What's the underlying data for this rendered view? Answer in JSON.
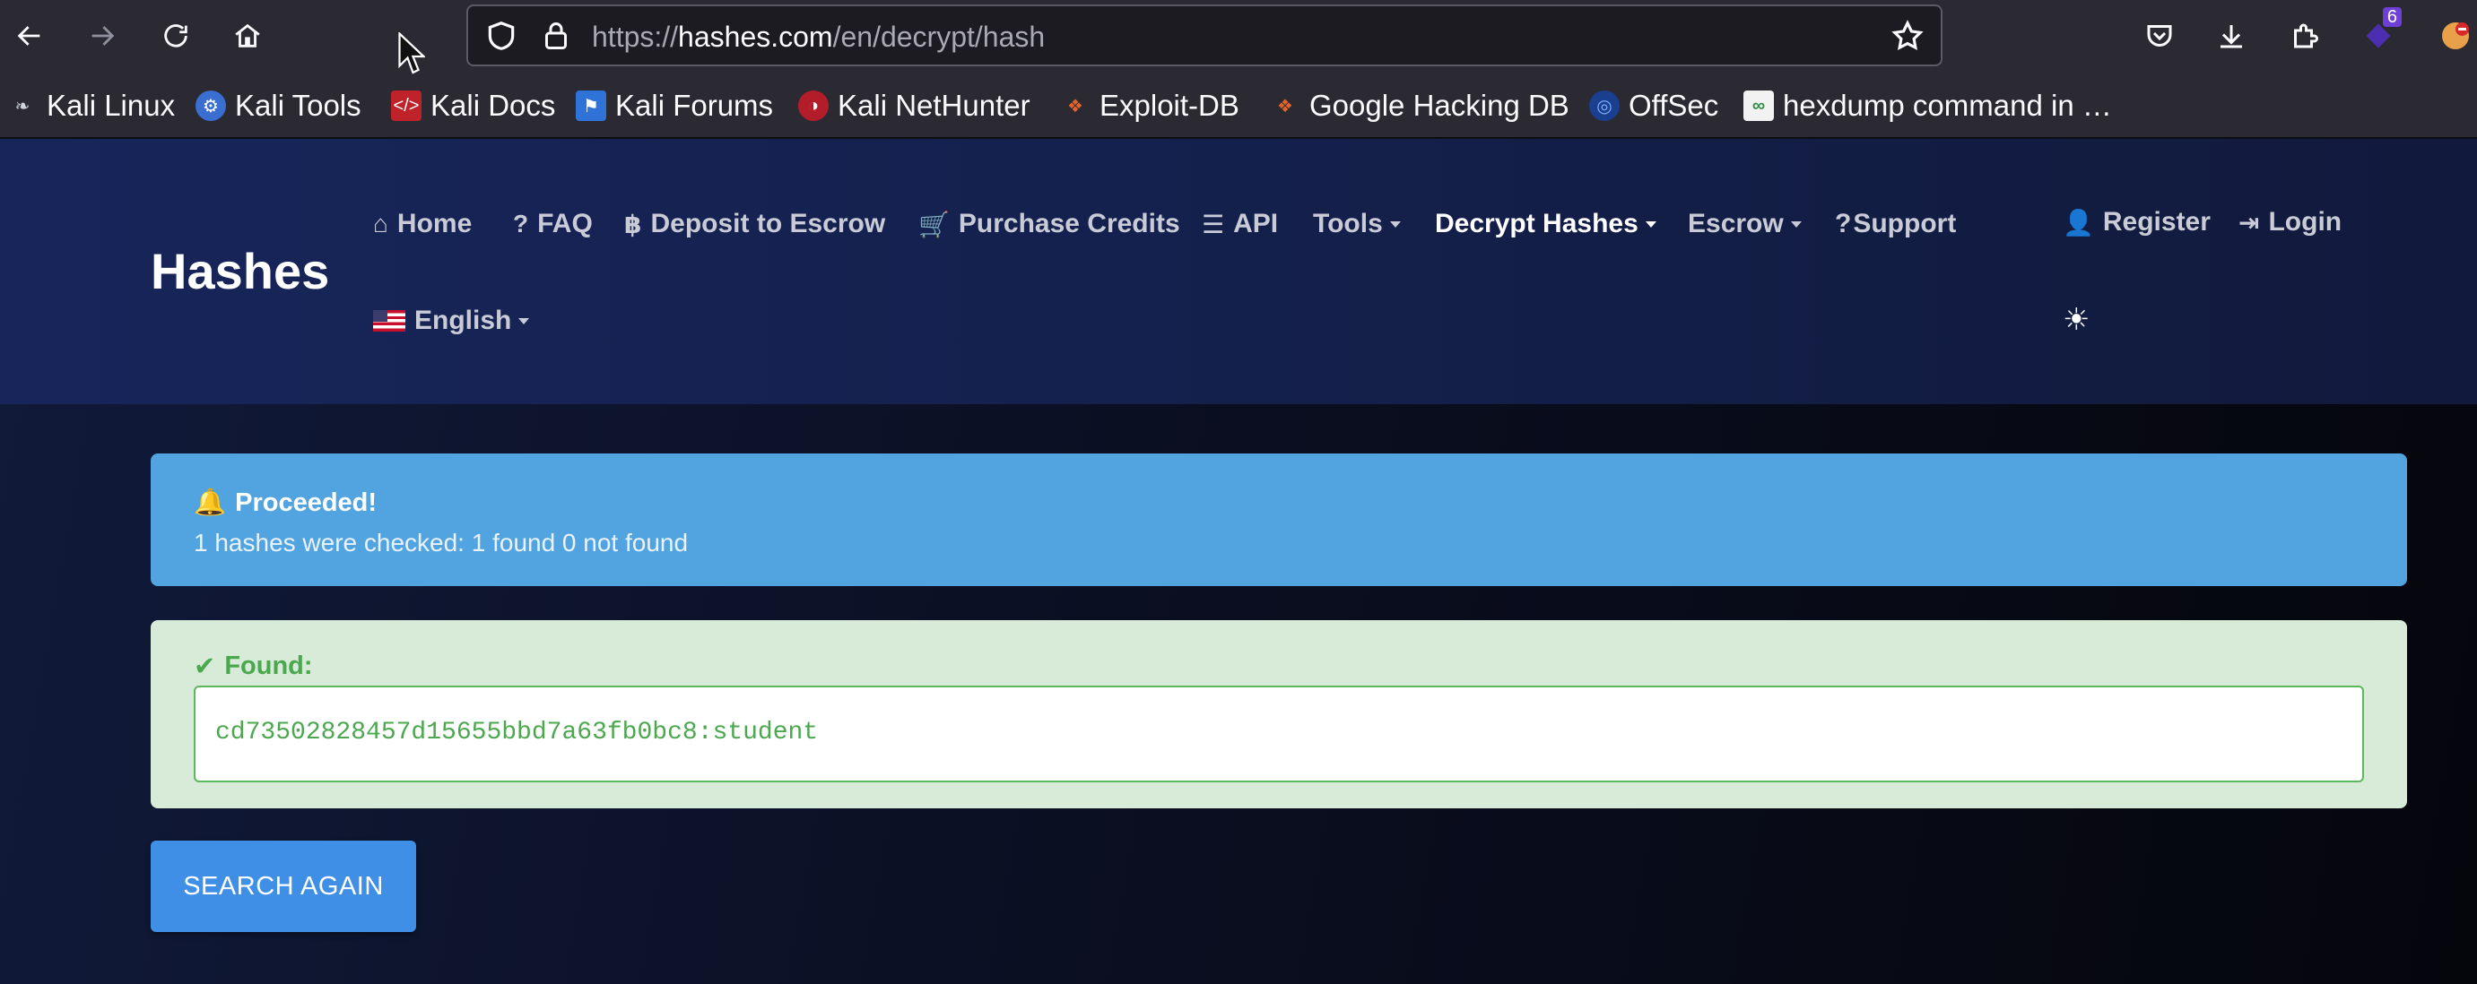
{
  "browser": {
    "url_scheme": "https://",
    "url_host": "hashes.com",
    "url_path": "/en/decrypt/hash",
    "extension_badge": "6",
    "bookmarks": [
      {
        "label": "Kali Linux",
        "icon": "kali-dragon-icon"
      },
      {
        "label": "Kali Tools",
        "icon": "kali-tools-icon"
      },
      {
        "label": "Kali Docs",
        "icon": "kali-docs-icon"
      },
      {
        "label": "Kali Forums",
        "icon": "kali-forums-icon"
      },
      {
        "label": "Kali NetHunter",
        "icon": "nethunter-icon"
      },
      {
        "label": "Exploit-DB",
        "icon": "exploit-db-icon"
      },
      {
        "label": "Google Hacking DB",
        "icon": "ghdb-icon"
      },
      {
        "label": "OffSec",
        "icon": "offsec-icon"
      },
      {
        "label": "hexdump command in …",
        "icon": "geeksforgeeks-icon"
      }
    ]
  },
  "site": {
    "brand": "Hashes",
    "nav": {
      "home": "Home",
      "faq": "FAQ",
      "deposit": "Deposit to Escrow",
      "purchase": "Purchase Credits",
      "api": "API",
      "tools": "Tools",
      "decrypt": "Decrypt Hashes",
      "escrow": "Escrow",
      "support": "Support",
      "register": "Register",
      "login": "Login",
      "language": "English"
    },
    "colors": {
      "info": "#52a4e0",
      "success_bg": "#d8ead8",
      "success_text": "#4ba84f",
      "button": "#3f8fe6"
    }
  },
  "result": {
    "info_title": "Proceeded!",
    "info_message": "1 hashes were checked: 1 found 0 not found",
    "found_title": "Found:",
    "found_value": "cd73502828457d15655bbd7a63fb0bc8:student",
    "search_again": "SEARCH AGAIN"
  }
}
